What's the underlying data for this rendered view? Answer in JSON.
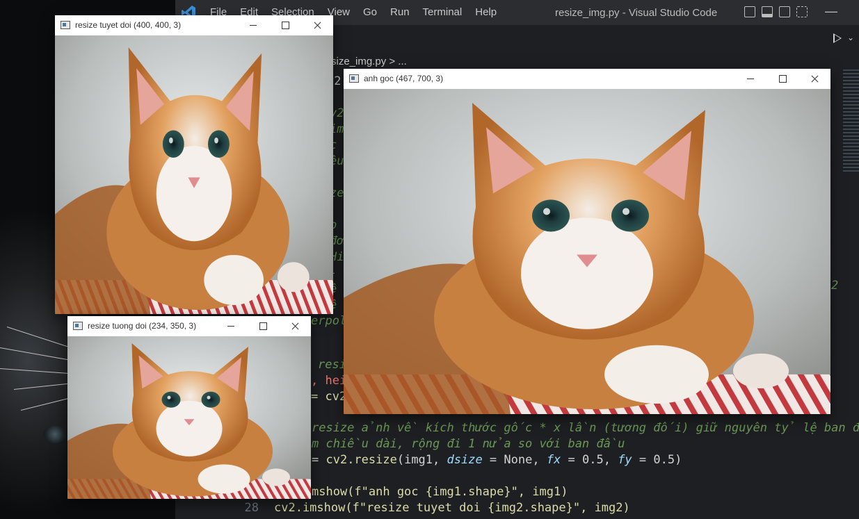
{
  "vscode": {
    "menu": [
      "File",
      "Edit",
      "Selection",
      "View",
      "Go",
      "Run",
      "Terminal",
      "Help"
    ],
    "window_title": "resize_img.py - Visual Studio Code",
    "breadcrumb": "size_img.py > ...",
    "code": {
      "line_a": "resize ảnh về kích thước gốc * x lần (tương đối) giữ nguyên tỷ lệ ban đầu.",
      "line_b": "m chiều dài, rộng đi 1 nửa so với ban đầu",
      "line_c_eq": "= ",
      "line_c_fn": "cv2.resize",
      "line_c_args": "(img1, ",
      "line_c_dsize": "dsize",
      "line_c_rest": " = None, ",
      "line_c_fx": "fx",
      "line_c_fxv": " = 0.5, ",
      "line_c_fy": "fy",
      "line_c_fyv": " = 0.5)",
      "line_d": "mshow(f\"anh goc {img1.shape}\", img1)",
      "line_e_num": "28",
      "line_e": "cv2.imshow(f\"resize tuyet doi {img2.shape}\", img2)",
      "frag_resi": "resi",
      "frag_hei": ", hei",
      "frag_cv2": "= cv2",
      "frag_erpol": "erpol",
      "frag_v2a": "v2",
      "frag_v2b": "v2",
      "frag_im": "im",
      "frag_c": "c",
      "frag_eu": "êu",
      "frag_ze": "ze",
      "frag_p": "p",
      "frag_do": "đơ",
      "frag_hi": "Hi",
      "frag_dash": "-",
      "frag_e1": "ệ",
      "frag_e2": "ệ",
      "frag_2": "2"
    }
  },
  "windows": [
    {
      "title": "resize tuyet doi (400, 400, 3)"
    },
    {
      "title": "anh goc (467, 700, 3)"
    },
    {
      "title": "resize tuong doi (234, 350, 3)"
    }
  ]
}
